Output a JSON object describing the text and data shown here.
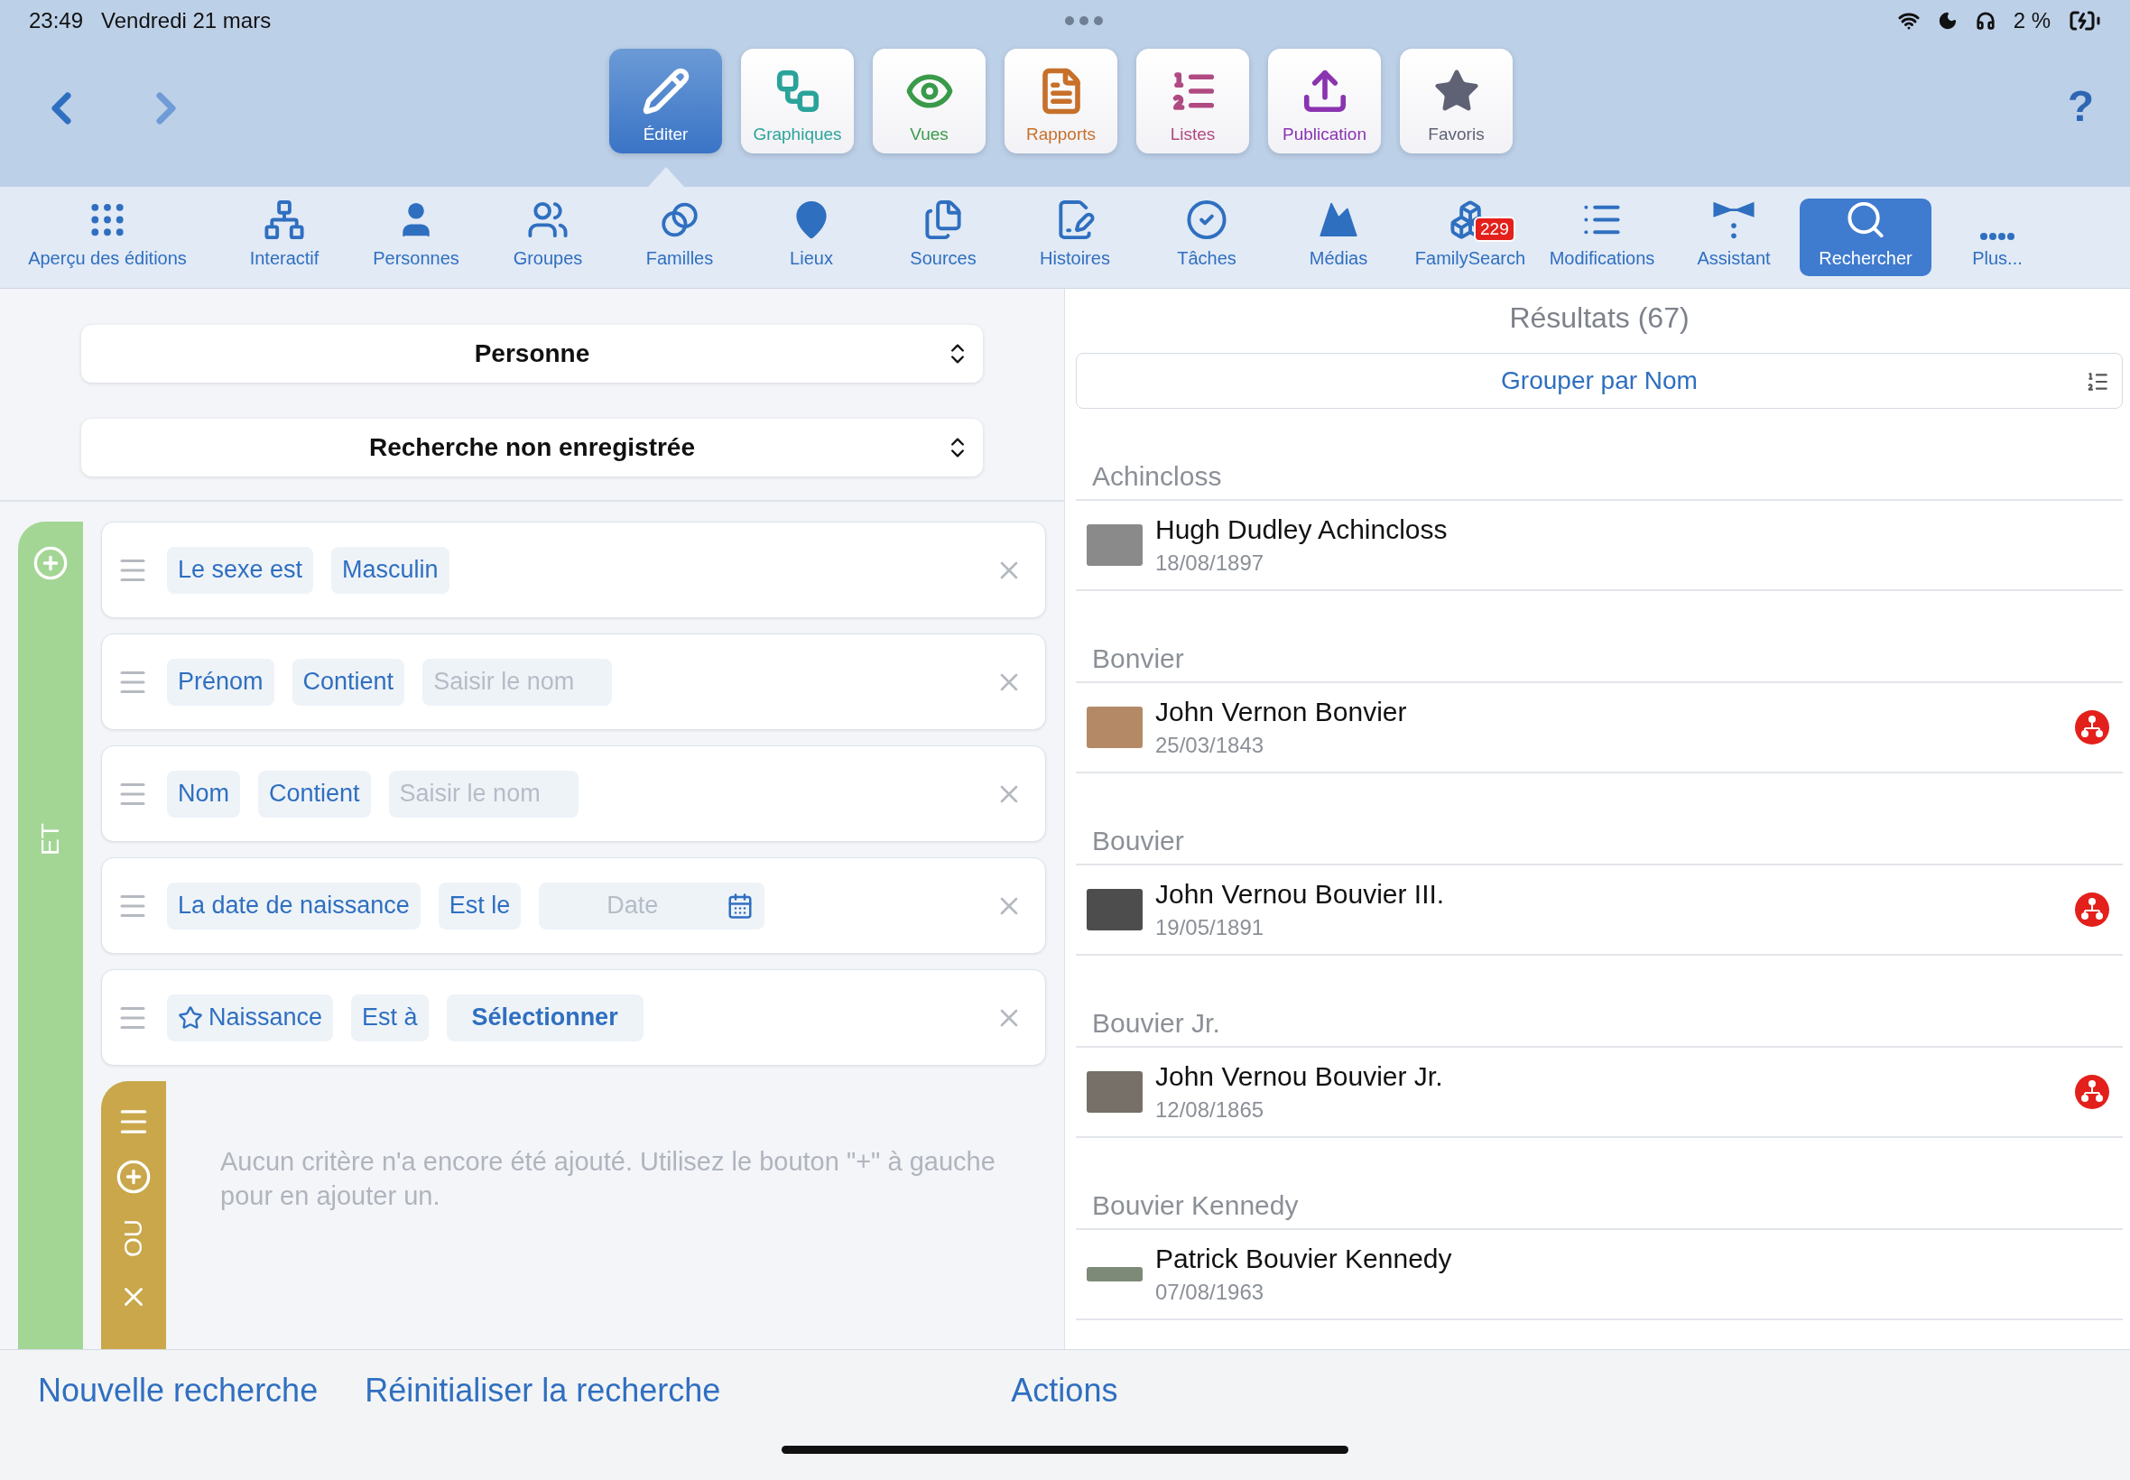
{
  "status_bar": {
    "time": "23:49",
    "date": "Vendredi 21 mars",
    "battery": "2 %"
  },
  "toolbar": {
    "help": "?",
    "buttons": [
      {
        "label": "Éditer",
        "kind": "pencil",
        "color": "#3a78c9",
        "selected": true
      },
      {
        "label": "Graphiques",
        "kind": "chart",
        "color": "#2aa39a",
        "selected": false
      },
      {
        "label": "Vues",
        "kind": "eye",
        "color": "#3a9a4a",
        "selected": false
      },
      {
        "label": "Rapports",
        "kind": "report",
        "color": "#c7702a",
        "selected": false
      },
      {
        "label": "Listes",
        "kind": "list",
        "color": "#b04a82",
        "selected": false
      },
      {
        "label": "Publication",
        "kind": "upload",
        "color": "#8a34b0",
        "selected": false
      },
      {
        "label": "Favoris",
        "kind": "star",
        "color": "#5f6275",
        "selected": false
      }
    ]
  },
  "nav": [
    {
      "label": "Aperçu des éditions",
      "kind": "dots",
      "selected": false
    },
    {
      "label": "Interactif",
      "kind": "tree",
      "selected": false
    },
    {
      "label": "Personnes",
      "kind": "person",
      "selected": false
    },
    {
      "label": "Groupes",
      "kind": "group",
      "selected": false
    },
    {
      "label": "Familles",
      "kind": "rings",
      "selected": false
    },
    {
      "label": "Lieux",
      "kind": "pin",
      "selected": false
    },
    {
      "label": "Sources",
      "kind": "files",
      "selected": false
    },
    {
      "label": "Histoires",
      "kind": "story",
      "selected": false
    },
    {
      "label": "Tâches",
      "kind": "check",
      "selected": false
    },
    {
      "label": "Médias",
      "kind": "media",
      "selected": false
    },
    {
      "label": "FamilySearch",
      "kind": "fs",
      "badge": "229",
      "selected": false
    },
    {
      "label": "Modifications",
      "kind": "lines",
      "selected": false
    },
    {
      "label": "Assistant",
      "kind": "bowtie",
      "selected": false
    },
    {
      "label": "Rechercher",
      "kind": "search",
      "selected": true
    },
    {
      "label": "Plus...",
      "kind": "more",
      "selected": false
    }
  ],
  "search": {
    "entity": "Personne",
    "saved_search": "Recherche non enregistrée",
    "and_label": "ET",
    "or_label": "OU",
    "criteria": [
      {
        "parts": [
          {
            "kind": "chip",
            "text": "Le sexe est"
          },
          {
            "kind": "chip",
            "text": "Masculin"
          }
        ]
      },
      {
        "parts": [
          {
            "kind": "chip",
            "text": "Prénom"
          },
          {
            "kind": "chip",
            "text": "Contient"
          },
          {
            "kind": "input",
            "placeholder": "Saisir le nom"
          }
        ]
      },
      {
        "parts": [
          {
            "kind": "chip",
            "text": "Nom"
          },
          {
            "kind": "chip",
            "text": "Contient"
          },
          {
            "kind": "input",
            "placeholder": "Saisir le nom"
          }
        ]
      },
      {
        "parts": [
          {
            "kind": "chip",
            "text": "La date de naissance"
          },
          {
            "kind": "chip",
            "text": "Est le"
          },
          {
            "kind": "date",
            "placeholder": "Date"
          }
        ]
      },
      {
        "parts": [
          {
            "kind": "star",
            "text": "Naissance"
          },
          {
            "kind": "chip",
            "text": "Est à"
          },
          {
            "kind": "action",
            "text": "Sélectionner"
          }
        ]
      }
    ],
    "empty_hint": "Aucun critère n'a encore été ajouté. Utilisez le bouton \"+\" à gauche pour en ajouter un."
  },
  "results": {
    "title": "Résultats (67)",
    "group_by": "Grouper par Nom",
    "groups": [
      {
        "name": "Achincloss",
        "people": [
          {
            "name": "Hugh Dudley Achincloss",
            "date": "18/08/1897",
            "tree_badge": false
          }
        ]
      },
      {
        "name": "Bonvier",
        "people": [
          {
            "name": "John Vernon Bonvier",
            "date": "25/03/1843",
            "tree_badge": true
          }
        ]
      },
      {
        "name": "Bouvier",
        "people": [
          {
            "name": "John Vernou Bouvier III.",
            "date": "19/05/1891",
            "tree_badge": true
          }
        ]
      },
      {
        "name": "Bouvier Jr.",
        "people": [
          {
            "name": "John Vernou Bouvier Jr.",
            "date": "12/08/1865",
            "tree_badge": true
          }
        ]
      },
      {
        "name": "Bouvier Kennedy",
        "people": [
          {
            "name": "Patrick Bouvier Kennedy",
            "date": "07/08/1963",
            "tree_badge": false
          }
        ]
      }
    ]
  },
  "bottom_bar": [
    "Nouvelle recherche",
    "Réinitialiser la recherche",
    "Actions"
  ]
}
